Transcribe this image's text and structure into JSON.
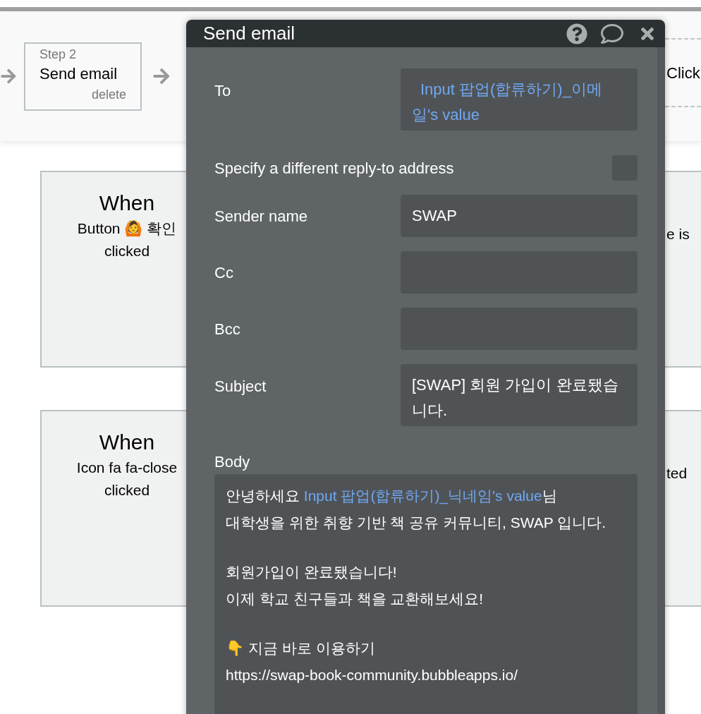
{
  "workflow": {
    "steps": [
      {
        "step": "Step 2",
        "action": "Send email",
        "delete": "delete"
      }
    ],
    "next_step": "Click"
  },
  "left_cards": [
    {
      "title": "When",
      "lines": [
        "Button 🙆 확인",
        "clicked"
      ]
    },
    {
      "title": "When",
      "lines": [
        "Icon fa fa-close",
        "clicked"
      ]
    }
  ],
  "right_cards": [
    {
      "lines": [
        "e is"
      ]
    },
    {
      "lines": [
        "ted"
      ]
    }
  ],
  "modal": {
    "title": "Send email",
    "fields": [
      {
        "kind": "field",
        "label": "To",
        "value": "Input 팝업(합류하기)_이메일's value",
        "dynamic": true
      },
      {
        "kind": "checkbox",
        "label": "Specify a different reply-to address",
        "checked": false
      },
      {
        "kind": "field",
        "label": "Sender name",
        "value": "SWAP",
        "dynamic": false
      },
      {
        "kind": "field",
        "label": "Cc"
      },
      {
        "kind": "field",
        "label": "Bcc"
      },
      {
        "kind": "field",
        "label": "Subject",
        "value": "[SWAP] 회원 가입이 완료됐습니다.",
        "dynamic": false,
        "tall": true
      }
    ],
    "body": {
      "label": "Body",
      "paragraphs": [
        [
          [
            {
              "text": "안녕하세요 ",
              "dynamic": false
            },
            {
              "text": "Input 팝업(합류하기)_닉네임's value",
              "dynamic": true
            },
            {
              "text": "님",
              "dynamic": false
            }
          ],
          [
            {
              "text": "대학생을 위한 취향 기반 책 공유 커뮤니티, SWAP 입니다.",
              "dynamic": false
            }
          ]
        ],
        [
          [
            {
              "text": "회원가입이 완료됐습니다!",
              "dynamic": false
            }
          ],
          [
            {
              "text": "이제 학교 친구들과 책을 교환해보세요!",
              "dynamic": false
            }
          ]
        ],
        [
          [
            {
              "text": "👇 지금 바로 이용하기",
              "dynamic": false
            }
          ],
          [
            {
              "text": "https://swap-book-community.bubbleapps.io/",
              "dynamic": false
            }
          ]
        ]
      ]
    }
  }
}
